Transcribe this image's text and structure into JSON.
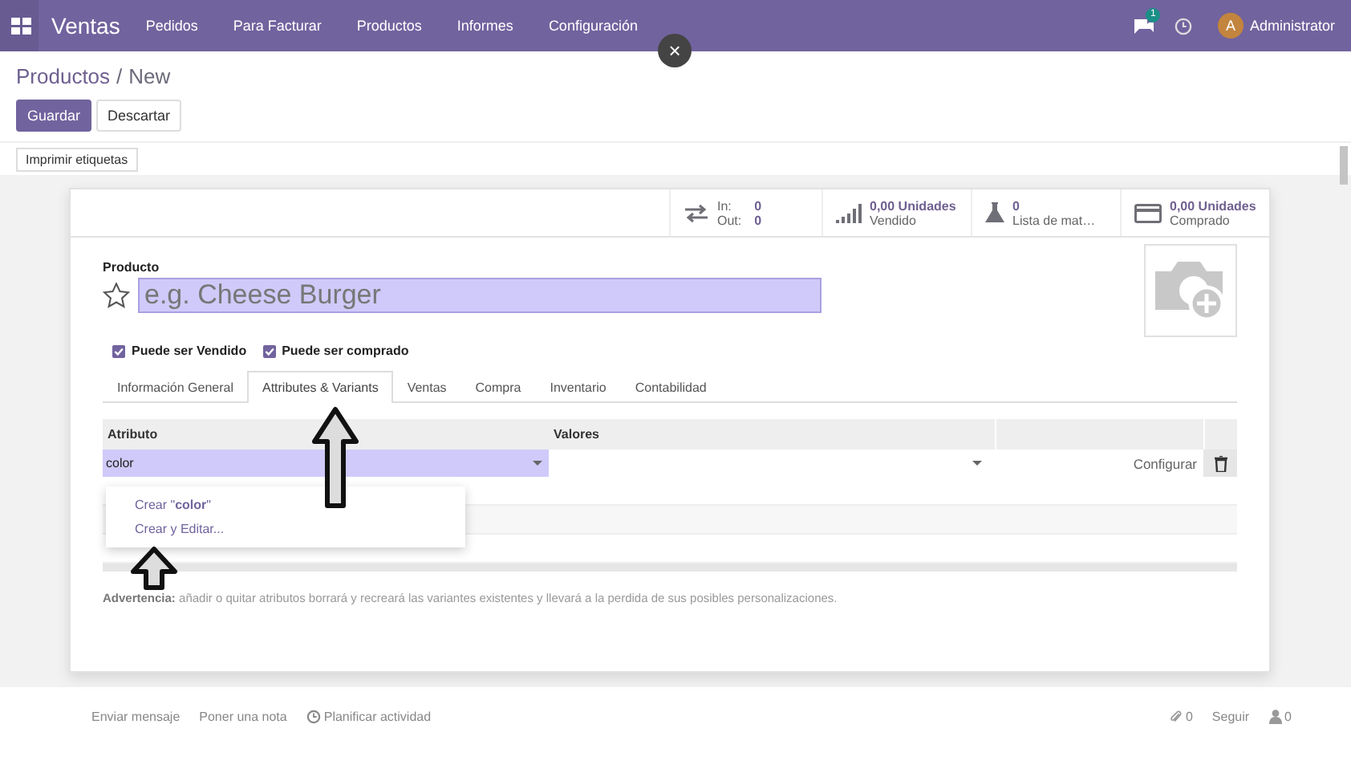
{
  "navbar": {
    "app_title": "Ventas",
    "menu": [
      "Pedidos",
      "Para Facturar",
      "Productos",
      "Informes",
      "Configuración"
    ],
    "messages_badge": "1",
    "user": {
      "initial": "A",
      "name": "Administrator"
    }
  },
  "close_button": "×",
  "breadcrumb": {
    "parent": "Productos",
    "separator": "/",
    "current": "New"
  },
  "buttons": [
    {
      "label": "Guardar",
      "kind": "primary"
    },
    {
      "label": "Descartar",
      "kind": "secondary"
    }
  ],
  "toolbar": [
    "Imprimir etiquetas"
  ],
  "stat_buttons": [
    {
      "kind": "in_out",
      "in_label": "In:",
      "in_value": "0",
      "out_label": "Out:",
      "out_value": "0"
    },
    {
      "kind": "sold",
      "value": "0,00 Unidades",
      "label": "Vendido"
    },
    {
      "kind": "bom",
      "value": "0",
      "label": "Lista de mat…"
    },
    {
      "kind": "purchased",
      "value": "0,00 Unidades",
      "label": "Comprado"
    }
  ],
  "product": {
    "label": "Producto",
    "placeholder": "e.g. Cheese Burger",
    "favorite": false
  },
  "checkboxes": [
    {
      "label": "Puede ser Vendido",
      "checked": true
    },
    {
      "label": "Puede ser comprado",
      "checked": true
    }
  ],
  "tabs": [
    {
      "label": "Información General",
      "selected": false
    },
    {
      "label": "Attributes & Variants",
      "selected": true
    },
    {
      "label": "Ventas",
      "selected": false
    },
    {
      "label": "Compra",
      "selected": false
    },
    {
      "label": "Inventario",
      "selected": false
    },
    {
      "label": "Contabilidad",
      "selected": false
    }
  ],
  "attributes": {
    "columns": [
      "Atributo",
      "Valores"
    ],
    "row": {
      "attribute": "color",
      "action": "Configurar"
    }
  },
  "dropdown": [
    "Crear \"**color**\"",
    "Crear y Editar..."
  ],
  "warning": "**Advertencia:** añadir o quitar atributos borrará y recreará las variantes existentes y llevará a la perdida de sus posibles personalizaciones.",
  "chatter": {
    "actions": [
      "Enviar mensaje",
      "Poner una nota",
      "Planificar actividad"
    ],
    "attachments": "0",
    "follow": "Seguir",
    "followers": "0"
  }
}
